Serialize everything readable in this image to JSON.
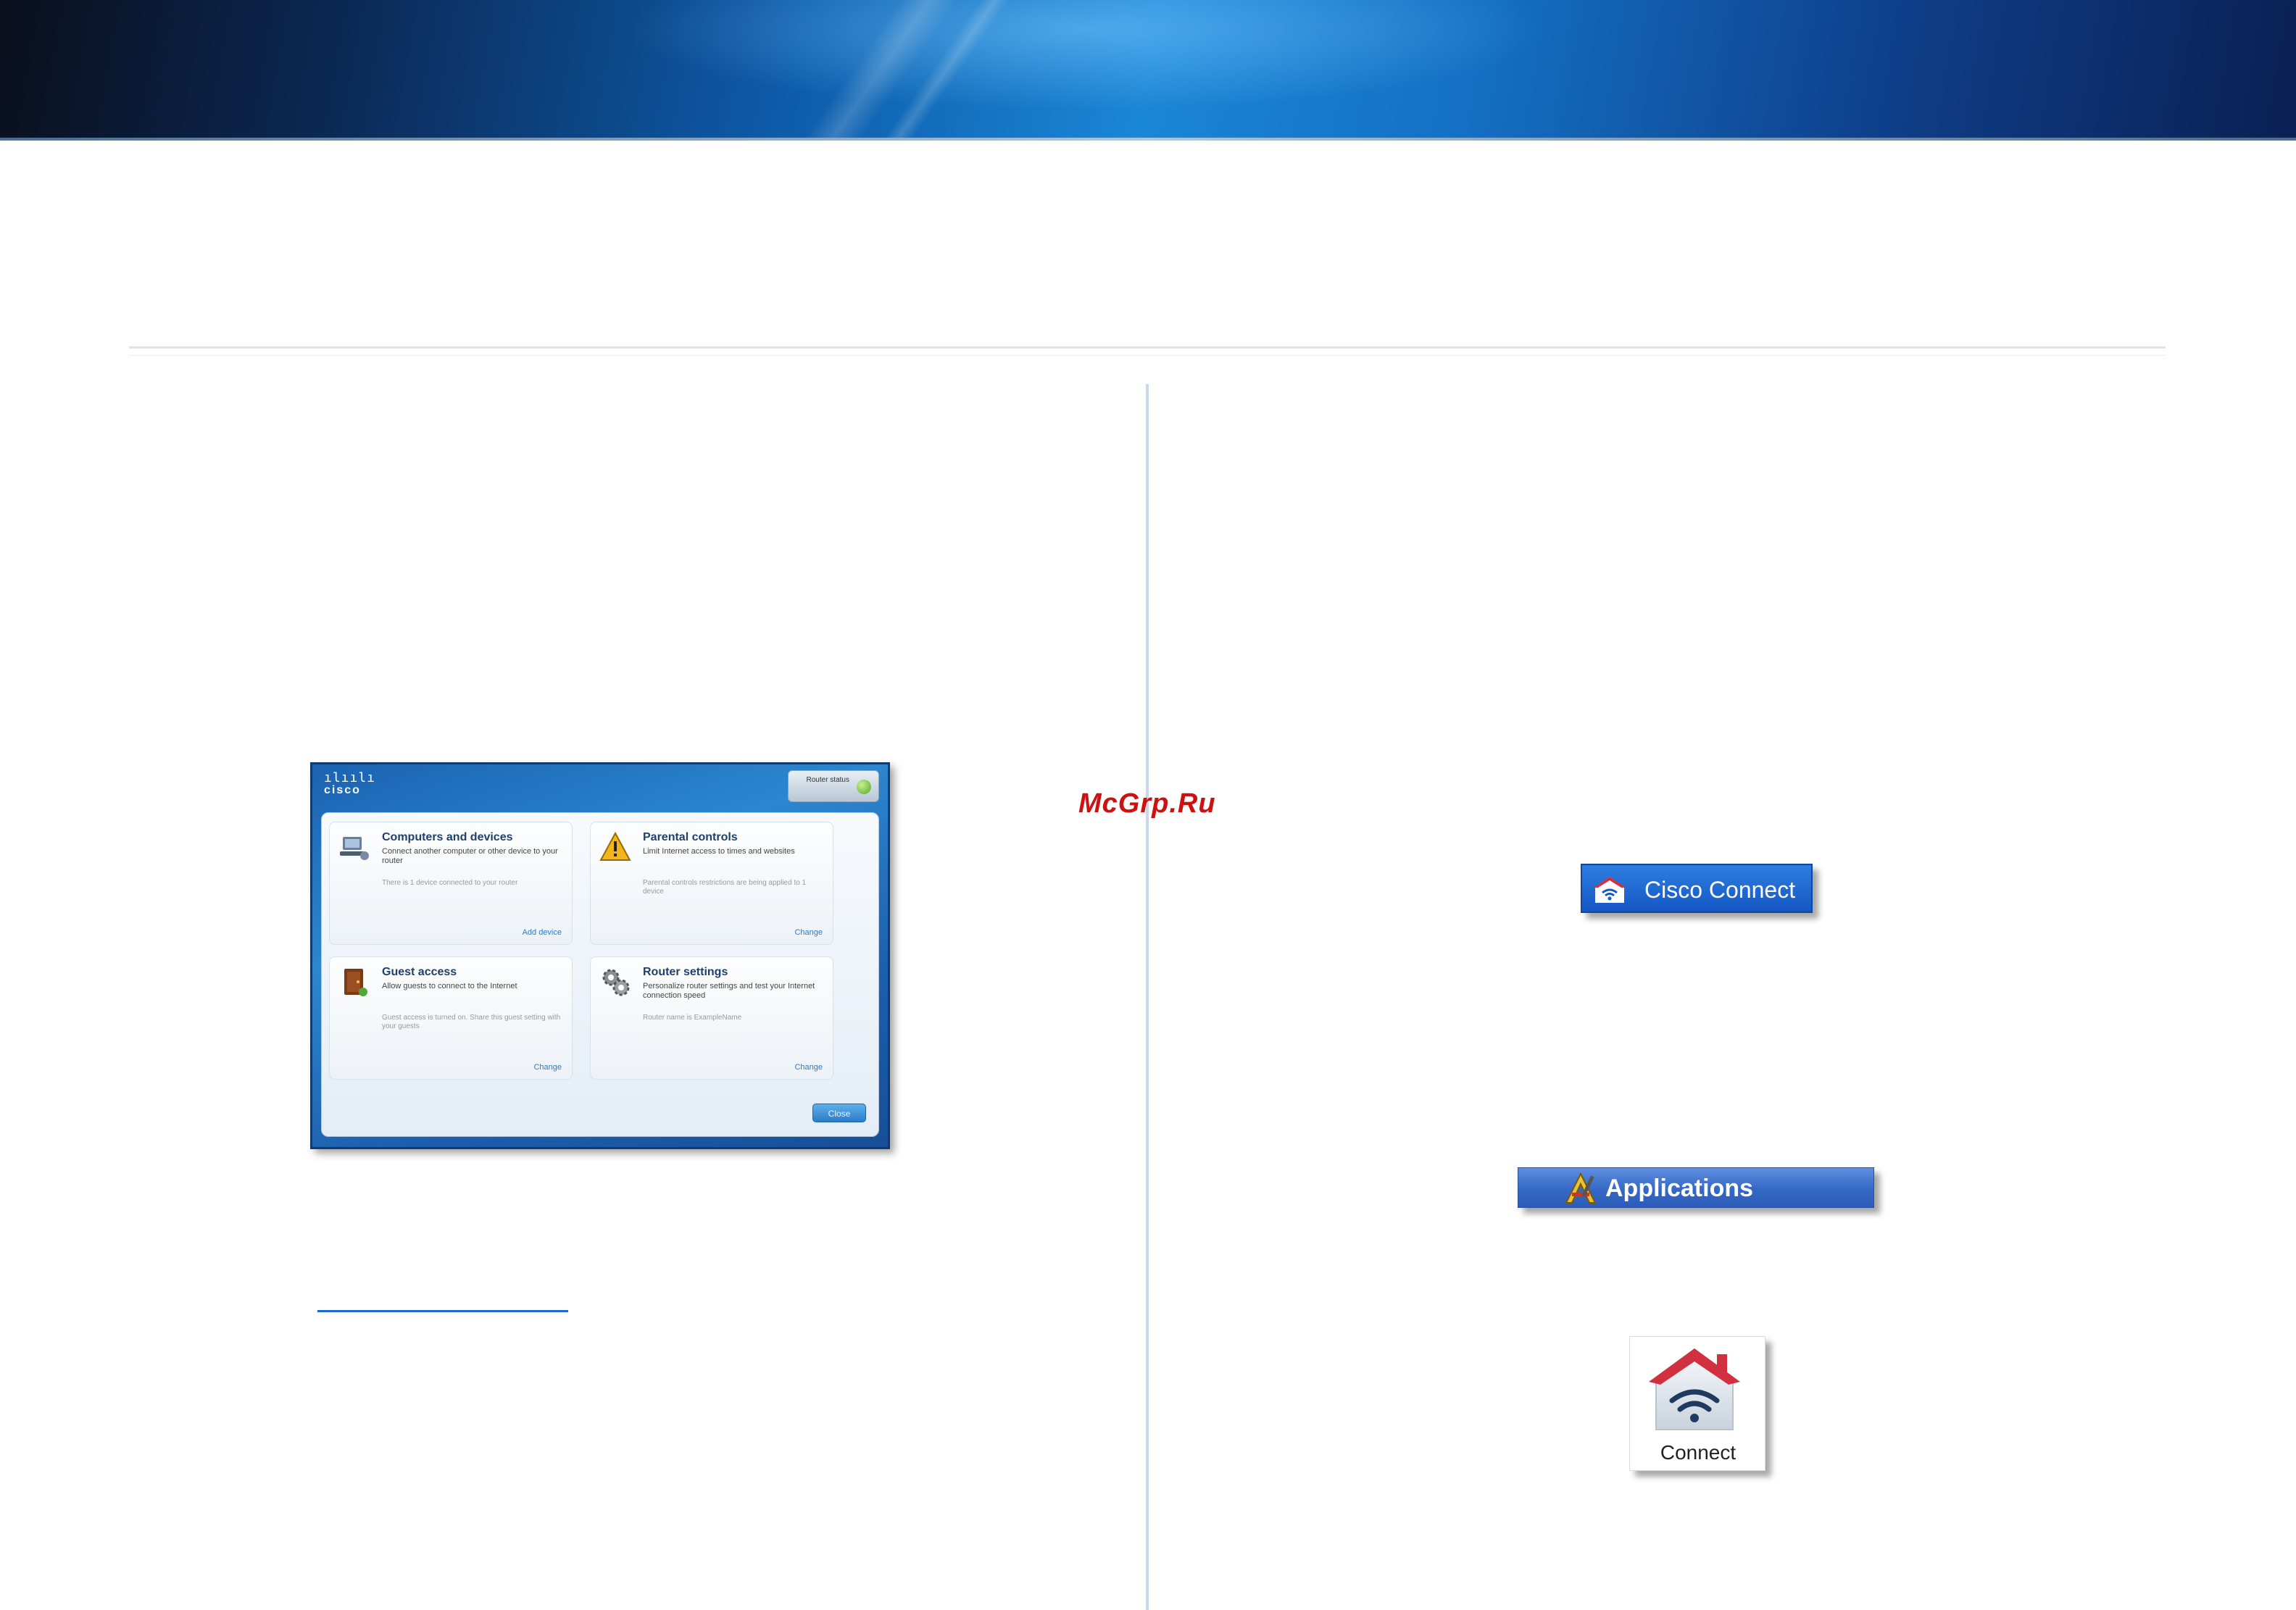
{
  "watermark": "McGrp.Ru",
  "app_window": {
    "logo_text": "cisco",
    "logo_bars": "ılıılı",
    "status_label": "Router status",
    "tiles": [
      {
        "title": "Computers and devices",
        "description": "Connect another computer or other device to your router",
        "status": "There is 1 device connected to your router",
        "action": "Add device"
      },
      {
        "title": "Parental controls",
        "description": "Limit Internet access to times and websites",
        "status": "Parental controls restrictions are being applied to 1 device",
        "action": "Change"
      },
      {
        "title": "Guest access",
        "description": "Allow guests to connect to the Internet",
        "status": "Guest access is turned on. Share this guest setting with your guests",
        "action": "Change"
      },
      {
        "title": "Router settings",
        "description": "Personalize router settings and test your Internet connection speed",
        "status": "Router name is ExampleName",
        "action": "Change"
      }
    ],
    "close_label": "Close"
  },
  "cisco_connect_button": {
    "label": "Cisco Connect"
  },
  "applications_bar": {
    "label": "Applications"
  },
  "connect_icon": {
    "label": "Connect"
  },
  "colors": {
    "accent_blue": "#1458c4",
    "house_red": "#d03040",
    "watermark_red": "#cc1111"
  }
}
